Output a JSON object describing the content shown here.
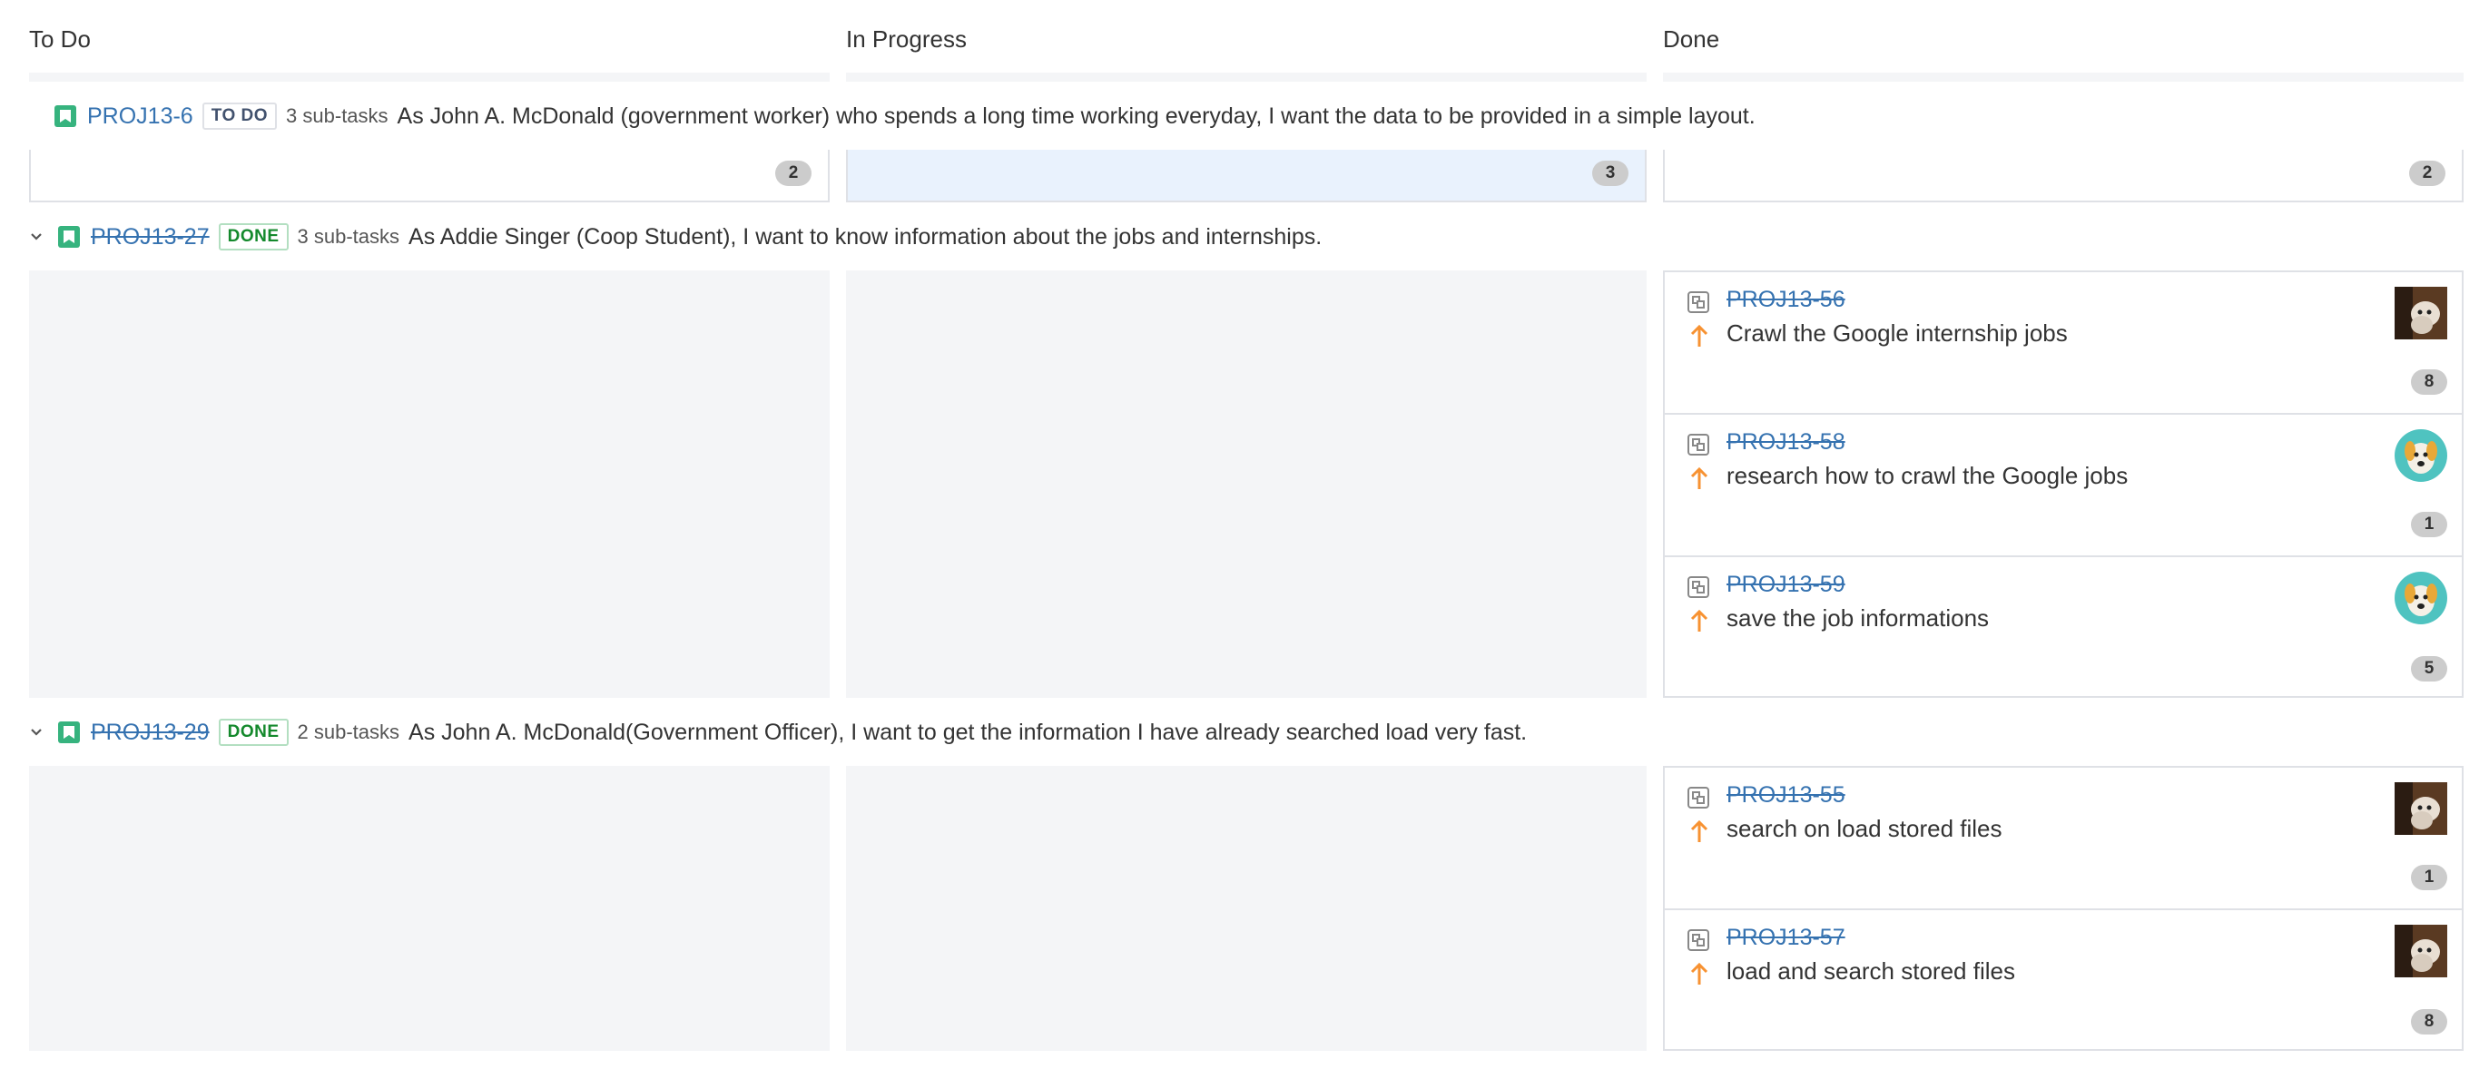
{
  "columns": [
    "To Do",
    "In Progress",
    "Done"
  ],
  "rows": [
    {
      "key": "PROJ13-6",
      "status": "TO DO",
      "subtasks": "3 sub-tasks",
      "summary": "As John A. McDonald (government worker) who spends a long time working everyday, I want the data to be provided in a simple layout.",
      "counts": [
        "2",
        "3",
        "2"
      ]
    },
    {
      "key": "PROJ13-27",
      "status": "DONE",
      "subtasks": "3 sub-tasks",
      "summary": "As Addie Singer (Coop Student), I want to know information about the jobs and internships.",
      "cards": [
        {
          "key": "PROJ13-56",
          "title": "Crawl the Google internship jobs",
          "count": "8",
          "avatar": "dog-photo"
        },
        {
          "key": "PROJ13-58",
          "title": "research how to crawl the Google jobs",
          "count": "1",
          "avatar": "cartoon-dog"
        },
        {
          "key": "PROJ13-59",
          "title": "save the job informations",
          "count": "5",
          "avatar": "cartoon-dog"
        }
      ]
    },
    {
      "key": "PROJ13-29",
      "status": "DONE",
      "subtasks": "2 sub-tasks",
      "summary": "As John A. McDonald(Government Officer), I want to get the information I have already searched load very fast.",
      "cards": [
        {
          "key": "PROJ13-55",
          "title": "search on load stored files",
          "count": "1",
          "avatar": "dog-photo"
        },
        {
          "key": "PROJ13-57",
          "title": "load and search stored files",
          "count": "8",
          "avatar": "dog-photo"
        }
      ]
    }
  ],
  "colors": {
    "link": "#3572b0",
    "story_green": "#36b37e",
    "done_green": "#14892c",
    "priority_orange": "#f79232",
    "highlight": "#e9f2fd"
  }
}
